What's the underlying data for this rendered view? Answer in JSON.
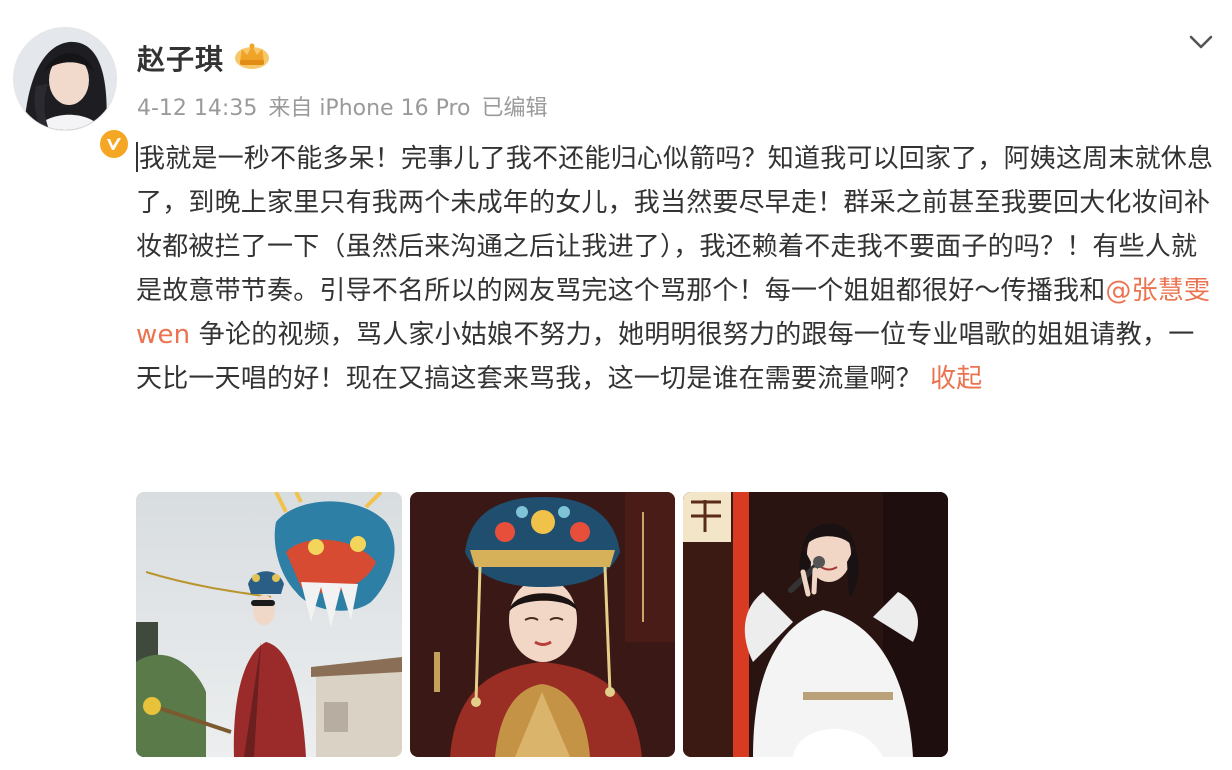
{
  "user": {
    "name": "赵子琪",
    "avatar_icon": "avatar-photo",
    "verified_icon": "verified-badge-icon",
    "vip_icon": "vip-crown-icon"
  },
  "post": {
    "date": "4-12 14:35",
    "source": "来自 iPhone 16 Pro",
    "edited": "已编辑",
    "text_before_mention": "我就是一秒不能多呆！完事儿了我不还能归心似箭吗？知道我可以回家了，阿姨这周末就休息了，到晚上家里只有我两个未成年的女儿，我当然要尽早走！群采之前甚至我要回大化妆间补妆都被拦了一下（虽然后来沟通之后让我进了），我还赖着不走我不要面子的吗？！有些人就是故意带节奏。引导不名所以的网友骂完这个骂那个！每一个姐姐都很好～传播我和",
    "mention": "@张慧雯wen",
    "text_after_mention": " 争论的视频，骂人家小姑娘不努力，她明明很努力的跟每一位专业唱歌的姐姐请教，一天比一天唱的好！现在又搞这套来骂我，这一切是谁在需要流量啊？",
    "collapse_label": "收起"
  },
  "colors": {
    "link": "#eb7350",
    "meta": "#9a9a9a",
    "text": "#333333",
    "badge": "#f5a623"
  },
  "photos": [
    {
      "icon": "photo-dragon-costume"
    },
    {
      "icon": "photo-headdress-portrait"
    },
    {
      "icon": "photo-singing-stage"
    }
  ]
}
